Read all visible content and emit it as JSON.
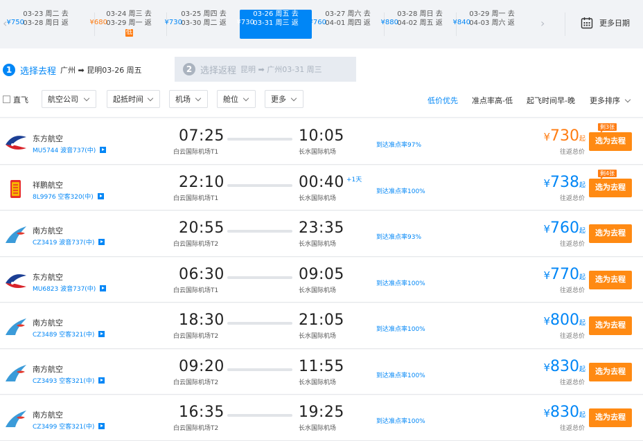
{
  "date_strip": {
    "prev_arrow": "‹",
    "next_arrow": "›",
    "cells": [
      {
        "out": "03-23 周二 去",
        "ret": "03-28 周日 返",
        "price": "¥750",
        "cheap": false,
        "low_badge": "",
        "active": false
      },
      {
        "out": "03-24 周三 去",
        "ret": "03-29 周一 返",
        "price": "¥680",
        "cheap": true,
        "low_badge": "低",
        "active": false
      },
      {
        "out": "03-25 周四 去",
        "ret": "03-30 周二 返",
        "price": "¥730",
        "cheap": false,
        "low_badge": "",
        "active": false
      },
      {
        "out": "03-26 周五 去",
        "ret": "03-31 周三 返",
        "price": "¥730",
        "cheap": false,
        "low_badge": "",
        "active": true
      },
      {
        "out": "03-27 周六 去",
        "ret": "04-01 周四 返",
        "price": "¥760",
        "cheap": false,
        "low_badge": "",
        "active": false
      },
      {
        "out": "03-28 周日 去",
        "ret": "04-02 周五 返",
        "price": "¥880",
        "cheap": false,
        "low_badge": "",
        "active": false
      },
      {
        "out": "03-29 周一 去",
        "ret": "04-03 周六 返",
        "price": "¥840",
        "cheap": false,
        "low_badge": "",
        "active": false
      }
    ],
    "more_dates": "更多日期"
  },
  "tabs": {
    "go": {
      "num": "1",
      "title": "选择去程",
      "route": "广州 ➡ 昆明03-26 周五"
    },
    "back": {
      "num": "2",
      "title": "选择返程",
      "route": "昆明 ➡ 广州03-31 周三"
    }
  },
  "filters": {
    "direct": "直飞",
    "dropdowns": [
      "航空公司",
      "起抵时间",
      "机场",
      "舱位",
      "更多"
    ],
    "sorts": [
      "低价优先",
      "准点率高-低",
      "起飞时间早-晚",
      "更多排序"
    ]
  },
  "flights": [
    {
      "airline": "东方航空",
      "logo": "china-eastern-logo",
      "flight_no": "MU5744 波音737(中)",
      "dep_time": "07:25",
      "dep_airport": "白云国际机场T1",
      "arr_time": "10:05",
      "arr_airport": "长水国际机场",
      "next_day": "",
      "ontime": "到达准点率97%",
      "price_cur": "¥",
      "price": "730",
      "price_suffix": "起",
      "price_color": "orange",
      "total_label": "往返总价",
      "seat_badge": "剩3张",
      "select_label": "选为去程"
    },
    {
      "airline": "祥鹏航空",
      "logo": "lucky-air-logo",
      "flight_no": "8L9976 空客320(中)",
      "dep_time": "22:10",
      "dep_airport": "白云国际机场T1",
      "arr_time": "00:40",
      "arr_airport": "长水国际机场",
      "next_day": "+1天",
      "ontime": "到达准点率100%",
      "price_cur": "¥",
      "price": "738",
      "price_suffix": "起",
      "price_color": "blue",
      "total_label": "往返总价",
      "seat_badge": "剩4张",
      "select_label": "选为去程"
    },
    {
      "airline": "南方航空",
      "logo": "china-southern-logo",
      "flight_no": "CZ3419 波音737(中)",
      "dep_time": "20:55",
      "dep_airport": "白云国际机场T2",
      "arr_time": "23:35",
      "arr_airport": "长水国际机场",
      "next_day": "",
      "ontime": "到达准点率93%",
      "price_cur": "¥",
      "price": "760",
      "price_suffix": "起",
      "price_color": "blue",
      "total_label": "往返总价",
      "seat_badge": "",
      "select_label": "选为去程"
    },
    {
      "airline": "东方航空",
      "logo": "china-eastern-logo",
      "flight_no": "MU6823 波音737(中)",
      "dep_time": "06:30",
      "dep_airport": "白云国际机场T1",
      "arr_time": "09:05",
      "arr_airport": "长水国际机场",
      "next_day": "",
      "ontime": "到达准点率100%",
      "price_cur": "¥",
      "price": "770",
      "price_suffix": "起",
      "price_color": "blue",
      "total_label": "往返总价",
      "seat_badge": "",
      "select_label": "选为去程"
    },
    {
      "airline": "南方航空",
      "logo": "china-southern-logo",
      "flight_no": "CZ3489 空客321(中)",
      "dep_time": "18:30",
      "dep_airport": "白云国际机场T2",
      "arr_time": "21:05",
      "arr_airport": "长水国际机场",
      "next_day": "",
      "ontime": "到达准点率100%",
      "price_cur": "¥",
      "price": "800",
      "price_suffix": "起",
      "price_color": "blue",
      "total_label": "往返总价",
      "seat_badge": "",
      "select_label": "选为去程"
    },
    {
      "airline": "南方航空",
      "logo": "china-southern-logo",
      "flight_no": "CZ3493 空客321(中)",
      "dep_time": "09:20",
      "dep_airport": "白云国际机场T2",
      "arr_time": "11:55",
      "arr_airport": "长水国际机场",
      "next_day": "",
      "ontime": "到达准点率100%",
      "price_cur": "¥",
      "price": "830",
      "price_suffix": "起",
      "price_color": "blue",
      "total_label": "往返总价",
      "seat_badge": "",
      "select_label": "选为去程"
    },
    {
      "airline": "南方航空",
      "logo": "china-southern-logo",
      "flight_no": "CZ3499 空客321(中)",
      "dep_time": "16:35",
      "dep_airport": "白云国际机场T2",
      "arr_time": "19:25",
      "arr_airport": "长水国际机场",
      "next_day": "",
      "ontime": "到达准点率100%",
      "price_cur": "¥",
      "price": "830",
      "price_suffix": "起",
      "price_color": "blue",
      "total_label": "往返总价",
      "seat_badge": "",
      "select_label": "选为去程"
    }
  ]
}
